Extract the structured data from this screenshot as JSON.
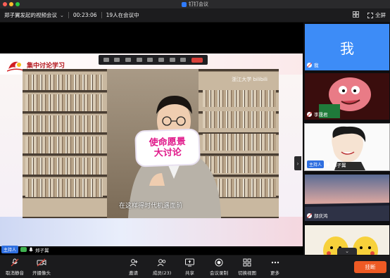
{
  "window": {
    "app_title": "钉钉会议",
    "colors": {
      "close": "#fe5f57",
      "minimize": "#febc2e",
      "zoom": "#28c840"
    }
  },
  "infobar": {
    "meeting_title": "郑子翼发起的视频会议",
    "timer": "00:23:06",
    "attendance": "19人在会议中",
    "fullscreen_label": "全屏"
  },
  "slide": {
    "heading": "集中讨论学习",
    "sign_line1": "使命愿景",
    "sign_line2": "大讨论",
    "caption": "在这样得时代机遇面前",
    "watermark": "浙江大学 bilibili"
  },
  "host_bar": {
    "host_badge": "主持人",
    "host_name": "郑子翼"
  },
  "participants": [
    {
      "name": "我",
      "avatar_text": "我",
      "muted": true
    },
    {
      "name": "李晟君",
      "muted": true
    },
    {
      "name": "郑子翼",
      "role_badge": "主持人",
      "muted": false,
      "active": true
    },
    {
      "name": "部庆鸿",
      "muted": true
    },
    {
      "name": "",
      "muted": true
    }
  ],
  "toolbar": {
    "mute_label": "取消静音",
    "camera_label": "开摄像头",
    "invite_label": "邀请",
    "members_label": "成员(23)",
    "share_label": "共享",
    "record_label": "会议录制",
    "switch_view_label": "切换视图",
    "more_label": "更多",
    "leave_label": "挂断",
    "members_count": "23"
  }
}
